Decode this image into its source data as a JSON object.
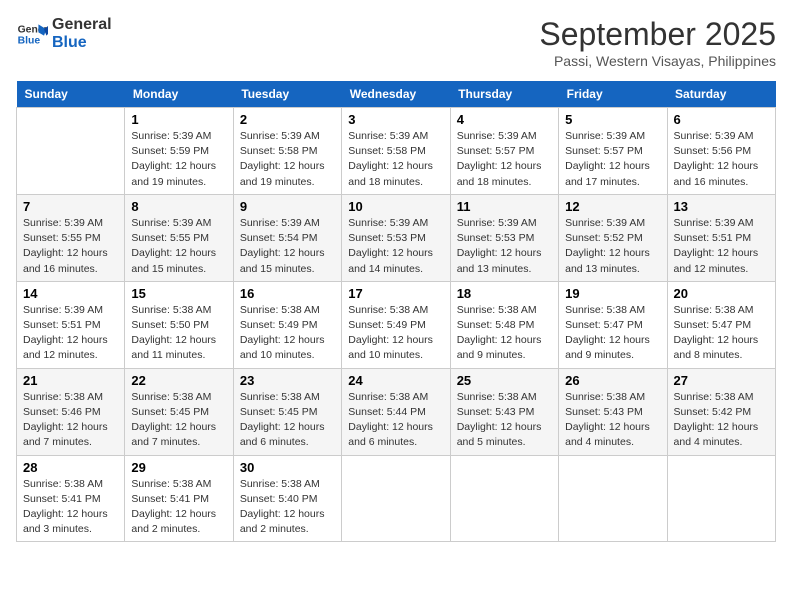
{
  "header": {
    "logo_line1": "General",
    "logo_line2": "Blue",
    "month": "September 2025",
    "location": "Passi, Western Visayas, Philippines"
  },
  "days_of_week": [
    "Sunday",
    "Monday",
    "Tuesday",
    "Wednesday",
    "Thursday",
    "Friday",
    "Saturday"
  ],
  "weeks": [
    [
      {
        "day": "",
        "info": ""
      },
      {
        "day": "1",
        "info": "Sunrise: 5:39 AM\nSunset: 5:59 PM\nDaylight: 12 hours\nand 19 minutes."
      },
      {
        "day": "2",
        "info": "Sunrise: 5:39 AM\nSunset: 5:58 PM\nDaylight: 12 hours\nand 19 minutes."
      },
      {
        "day": "3",
        "info": "Sunrise: 5:39 AM\nSunset: 5:58 PM\nDaylight: 12 hours\nand 18 minutes."
      },
      {
        "day": "4",
        "info": "Sunrise: 5:39 AM\nSunset: 5:57 PM\nDaylight: 12 hours\nand 18 minutes."
      },
      {
        "day": "5",
        "info": "Sunrise: 5:39 AM\nSunset: 5:57 PM\nDaylight: 12 hours\nand 17 minutes."
      },
      {
        "day": "6",
        "info": "Sunrise: 5:39 AM\nSunset: 5:56 PM\nDaylight: 12 hours\nand 16 minutes."
      }
    ],
    [
      {
        "day": "7",
        "info": "Sunrise: 5:39 AM\nSunset: 5:55 PM\nDaylight: 12 hours\nand 16 minutes."
      },
      {
        "day": "8",
        "info": "Sunrise: 5:39 AM\nSunset: 5:55 PM\nDaylight: 12 hours\nand 15 minutes."
      },
      {
        "day": "9",
        "info": "Sunrise: 5:39 AM\nSunset: 5:54 PM\nDaylight: 12 hours\nand 15 minutes."
      },
      {
        "day": "10",
        "info": "Sunrise: 5:39 AM\nSunset: 5:53 PM\nDaylight: 12 hours\nand 14 minutes."
      },
      {
        "day": "11",
        "info": "Sunrise: 5:39 AM\nSunset: 5:53 PM\nDaylight: 12 hours\nand 13 minutes."
      },
      {
        "day": "12",
        "info": "Sunrise: 5:39 AM\nSunset: 5:52 PM\nDaylight: 12 hours\nand 13 minutes."
      },
      {
        "day": "13",
        "info": "Sunrise: 5:39 AM\nSunset: 5:51 PM\nDaylight: 12 hours\nand 12 minutes."
      }
    ],
    [
      {
        "day": "14",
        "info": "Sunrise: 5:39 AM\nSunset: 5:51 PM\nDaylight: 12 hours\nand 12 minutes."
      },
      {
        "day": "15",
        "info": "Sunrise: 5:38 AM\nSunset: 5:50 PM\nDaylight: 12 hours\nand 11 minutes."
      },
      {
        "day": "16",
        "info": "Sunrise: 5:38 AM\nSunset: 5:49 PM\nDaylight: 12 hours\nand 10 minutes."
      },
      {
        "day": "17",
        "info": "Sunrise: 5:38 AM\nSunset: 5:49 PM\nDaylight: 12 hours\nand 10 minutes."
      },
      {
        "day": "18",
        "info": "Sunrise: 5:38 AM\nSunset: 5:48 PM\nDaylight: 12 hours\nand 9 minutes."
      },
      {
        "day": "19",
        "info": "Sunrise: 5:38 AM\nSunset: 5:47 PM\nDaylight: 12 hours\nand 9 minutes."
      },
      {
        "day": "20",
        "info": "Sunrise: 5:38 AM\nSunset: 5:47 PM\nDaylight: 12 hours\nand 8 minutes."
      }
    ],
    [
      {
        "day": "21",
        "info": "Sunrise: 5:38 AM\nSunset: 5:46 PM\nDaylight: 12 hours\nand 7 minutes."
      },
      {
        "day": "22",
        "info": "Sunrise: 5:38 AM\nSunset: 5:45 PM\nDaylight: 12 hours\nand 7 minutes."
      },
      {
        "day": "23",
        "info": "Sunrise: 5:38 AM\nSunset: 5:45 PM\nDaylight: 12 hours\nand 6 minutes."
      },
      {
        "day": "24",
        "info": "Sunrise: 5:38 AM\nSunset: 5:44 PM\nDaylight: 12 hours\nand 6 minutes."
      },
      {
        "day": "25",
        "info": "Sunrise: 5:38 AM\nSunset: 5:43 PM\nDaylight: 12 hours\nand 5 minutes."
      },
      {
        "day": "26",
        "info": "Sunrise: 5:38 AM\nSunset: 5:43 PM\nDaylight: 12 hours\nand 4 minutes."
      },
      {
        "day": "27",
        "info": "Sunrise: 5:38 AM\nSunset: 5:42 PM\nDaylight: 12 hours\nand 4 minutes."
      }
    ],
    [
      {
        "day": "28",
        "info": "Sunrise: 5:38 AM\nSunset: 5:41 PM\nDaylight: 12 hours\nand 3 minutes."
      },
      {
        "day": "29",
        "info": "Sunrise: 5:38 AM\nSunset: 5:41 PM\nDaylight: 12 hours\nand 2 minutes."
      },
      {
        "day": "30",
        "info": "Sunrise: 5:38 AM\nSunset: 5:40 PM\nDaylight: 12 hours\nand 2 minutes."
      },
      {
        "day": "",
        "info": ""
      },
      {
        "day": "",
        "info": ""
      },
      {
        "day": "",
        "info": ""
      },
      {
        "day": "",
        "info": ""
      }
    ]
  ]
}
